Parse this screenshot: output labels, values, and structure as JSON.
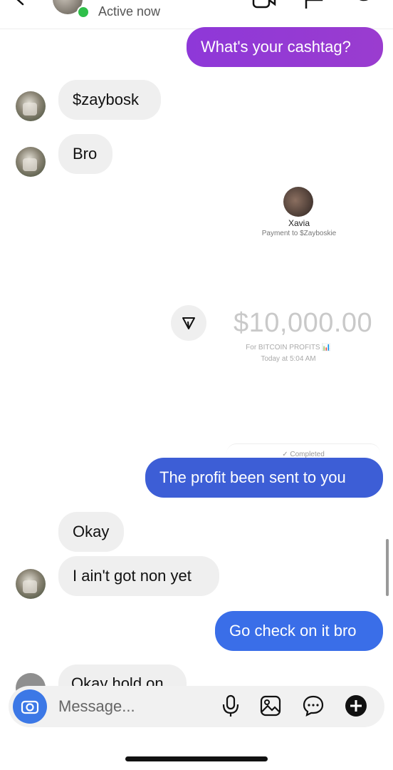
{
  "header": {
    "status": "Active now"
  },
  "messages": {
    "m1": "What's your cashtag?",
    "m2": "$zaybosk",
    "m3": "Bro",
    "m4": "The profit been sent to you",
    "m5": "Okay",
    "m6": "I ain't got non yet",
    "m7": "Go check on it bro",
    "m8": "Okay hold on"
  },
  "payment_card": {
    "name": "Xavia",
    "subtitle": "Payment to $Zayboskie",
    "amount": "$10,000.00",
    "note": "For BITCOIN PROFITS 📊",
    "time": "Today at 5:04 AM",
    "status": "✓ Completed"
  },
  "composer": {
    "placeholder": "Message..."
  },
  "colors": {
    "purple_bubble": "#9a3ccf",
    "blue_bubble": "#3d5ed6",
    "incoming_bubble": "#efefef",
    "online": "#2fbf4a",
    "camera_button": "#3c78e6"
  }
}
